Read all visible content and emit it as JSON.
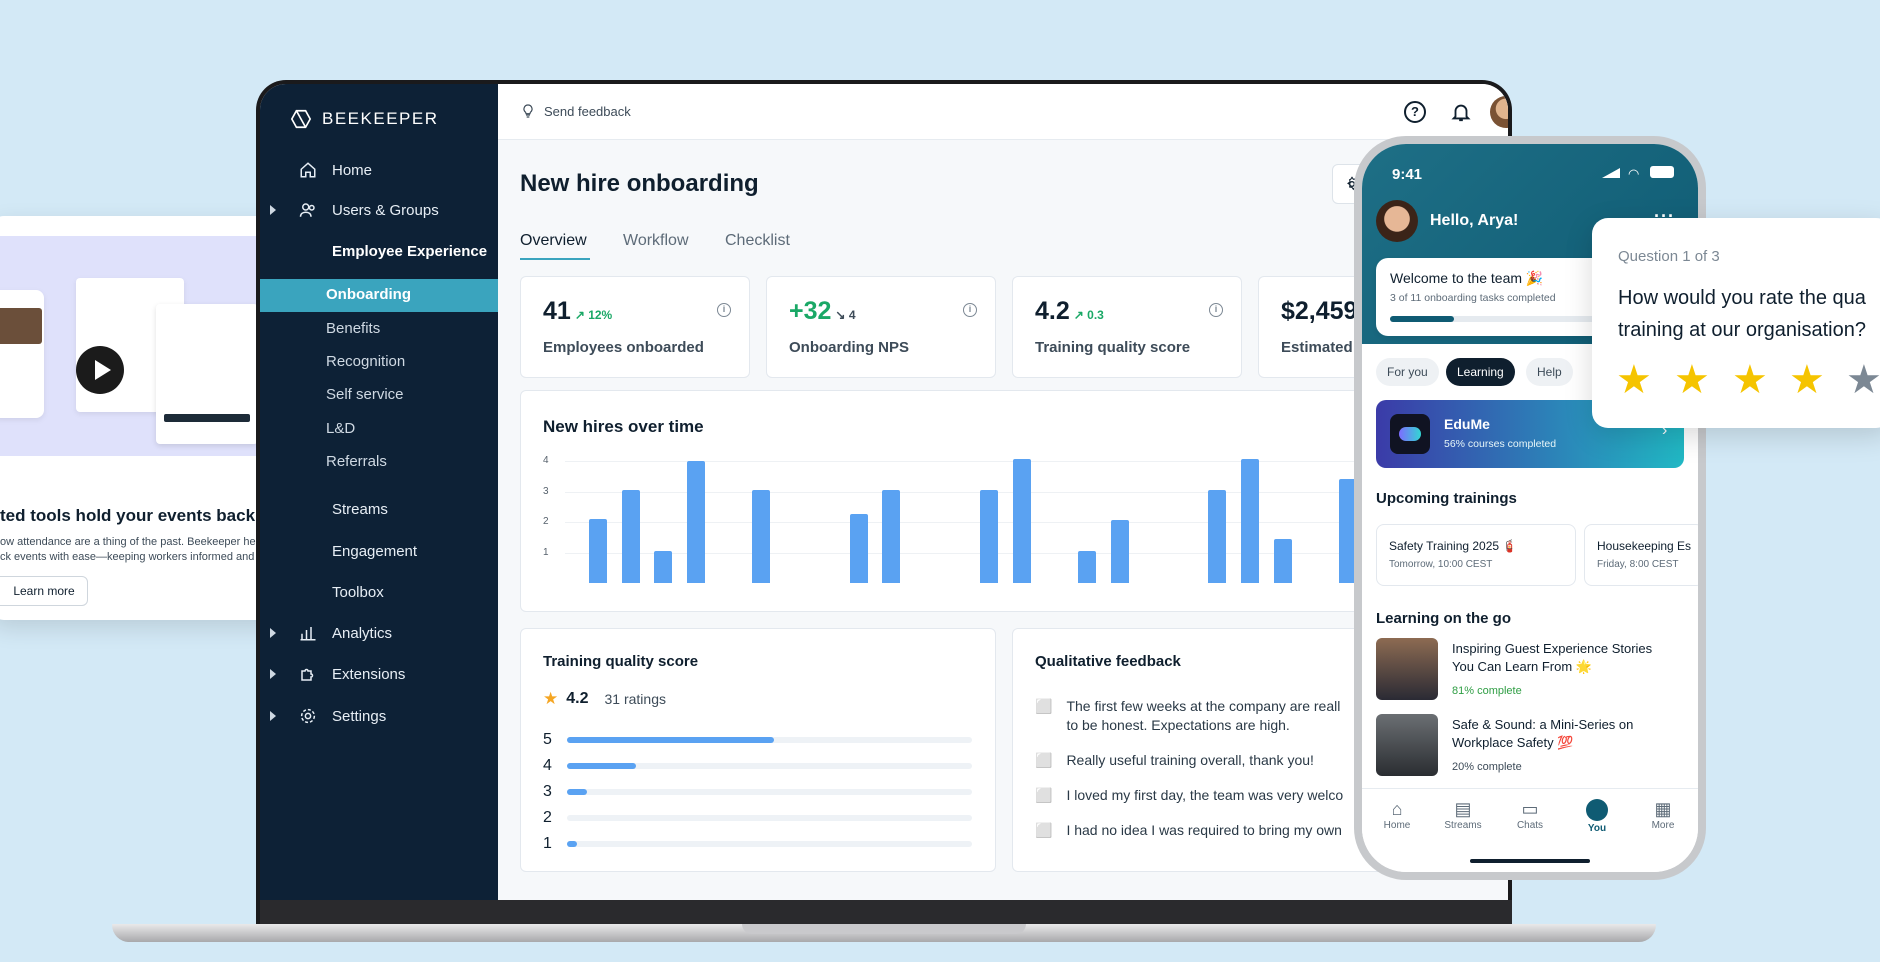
{
  "brand": "BEEKEEPER",
  "topbar": {
    "send_feedback": "Send feedback"
  },
  "sidebar": {
    "items": [
      {
        "label": "Home",
        "icon": "home-icon"
      },
      {
        "label": "Users & Groups",
        "icon": "users-icon"
      },
      {
        "label": "Employee Experience",
        "icon": "employee-experience-icon"
      },
      {
        "label": "Streams",
        "icon": "streams-icon"
      },
      {
        "label": "Engagement",
        "icon": "engagement-icon"
      },
      {
        "label": "Toolbox",
        "icon": "toolbox-icon"
      },
      {
        "label": "Analytics",
        "icon": "analytics-icon"
      },
      {
        "label": "Extensions",
        "icon": "extensions-icon"
      },
      {
        "label": "Settings",
        "icon": "settings-icon"
      }
    ],
    "sub_items": [
      "Onboarding",
      "Benefits",
      "Recognition",
      "Self service",
      "L&D",
      "Referrals"
    ]
  },
  "page": {
    "title": "New hire onboarding",
    "tabs": [
      "Overview",
      "Workflow",
      "Checklist"
    ]
  },
  "kpis": [
    {
      "value": "41",
      "delta": "12%",
      "label": "Employees onboarded"
    },
    {
      "value": "+32",
      "delta": "4",
      "label": "Onboarding NPS"
    },
    {
      "value": "4.2",
      "delta": "0.3",
      "label": "Training quality score"
    },
    {
      "value": "$2,459",
      "label": "Estimated s"
    }
  ],
  "chart_data": {
    "type": "bar",
    "title": "New hires over time",
    "yticks": [
      "1",
      "2",
      "3",
      "4"
    ],
    "ylim": [
      0,
      4
    ],
    "values": [
      2.1,
      3.05,
      1.05,
      4.0,
      0,
      3.05,
      0,
      0,
      2.25,
      3.05,
      0,
      0,
      3.05,
      4.05,
      0,
      1.05,
      2.05,
      0,
      0,
      3.05,
      4.05,
      1.45,
      0,
      3.4
    ],
    "grid": true
  },
  "training": {
    "title": "Training quality score",
    "score": "4.2",
    "ratings": "31 ratings",
    "rows": [
      {
        "label": "5",
        "fraction": 0.51
      },
      {
        "label": "4",
        "fraction": 0.17
      },
      {
        "label": "3",
        "fraction": 0.05
      },
      {
        "label": "2",
        "fraction": 0.0
      },
      {
        "label": "1",
        "fraction": 0.025
      }
    ]
  },
  "feedback": {
    "title": "Qualitative feedback",
    "items": [
      {
        "type": "negative",
        "text": "The first few weeks at the company are reall",
        "text2": "to be honest. Expectations are high."
      },
      {
        "type": "positive",
        "text": "Really useful training overall, thank you!"
      },
      {
        "type": "positive",
        "text": "I loved my first day, the team was very welco"
      },
      {
        "type": "negative",
        "text": "I had no idea I was required to bring my own"
      }
    ]
  },
  "left_card": {
    "headline": "ted tools hold your events back",
    "body1": "ow attendance are a thing of the past. Beekeeper helps you",
    "body2": "ck events with ease—keeping workers informed and engaged.",
    "cta": "Learn more"
  },
  "phone": {
    "time": "9:41",
    "greeting": "Hello, Arya!",
    "welcome_title": "Welcome to the team 🎉",
    "welcome_sub": "3 of 11 onboarding tasks completed",
    "welcome_progress": 0.27,
    "pills": [
      "For you",
      "Learning",
      "Help"
    ],
    "edume_title": "EduMe",
    "edume_sub": "56% courses completed",
    "upcoming_title": "Upcoming trainings",
    "trainings": [
      {
        "title": "Safety Training 2025 🧯",
        "time": "Tomorrow, 10:00 CEST"
      },
      {
        "title": "Housekeeping Es",
        "time": "Friday, 8:00 CEST"
      }
    ],
    "learning_title": "Learning on the go",
    "courses": [
      {
        "title1": "Inspiring Guest Experience Stories",
        "title2": "You Can Learn From 🌟",
        "progress": "81% complete"
      },
      {
        "title1": "Safe & Sound: a Mini-Series on",
        "title2": "Workplace Safety 💯",
        "progress": "20% complete"
      }
    ],
    "nav": [
      "Home",
      "Streams",
      "Chats",
      "You",
      "More"
    ]
  },
  "survey": {
    "counter": "Question 1 of 3",
    "question1": "How would you rate the qua",
    "question2": "training at our organisation?",
    "stars_filled": 4
  }
}
